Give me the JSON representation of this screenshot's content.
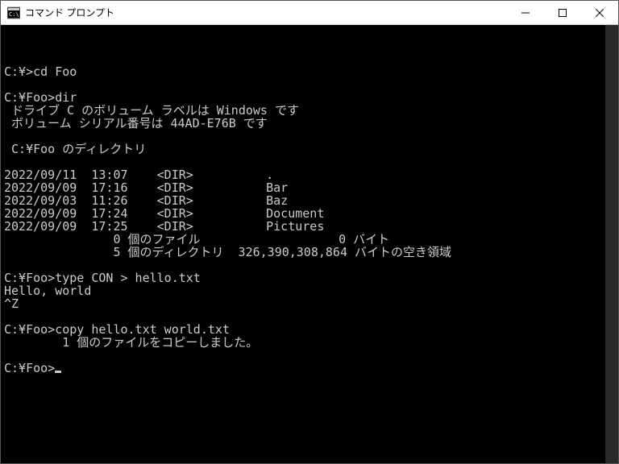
{
  "window": {
    "title": "コマンド プロンプト"
  },
  "terminal": {
    "lines": [
      "",
      "C:\\>cd Foo",
      "",
      "C:\\Foo>dir",
      " ドライブ C のボリューム ラベルは Windows です",
      " ボリューム シリアル番号は 44AD-E76B です",
      "",
      " C:\\Foo のディレクトリ",
      "",
      "2022/09/11  13:07    <DIR>          .",
      "2022/09/09  17:16    <DIR>          Bar",
      "2022/09/03  11:26    <DIR>          Baz",
      "2022/09/09  17:24    <DIR>          Document",
      "2022/09/09  17:25    <DIR>          Pictures",
      "               0 個のファイル                   0 バイト",
      "               5 個のディレクトリ  326,390,308,864 バイトの空き領域",
      "",
      "C:\\Foo>type CON > hello.txt",
      "Hello, world",
      "^Z",
      "",
      "C:\\Foo>copy hello.txt world.txt",
      "        1 個のファイルをコピーしました。",
      "",
      "C:\\Foo>"
    ]
  }
}
